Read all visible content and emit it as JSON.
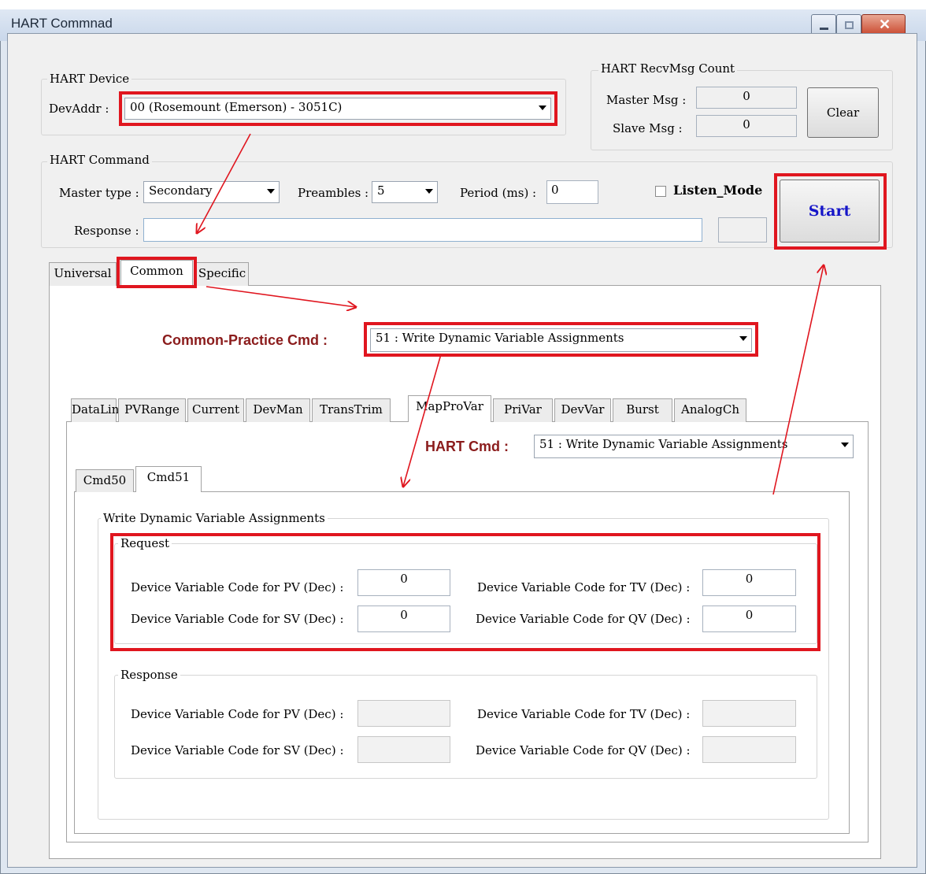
{
  "window": {
    "title": "HART Commnad"
  },
  "hart_device": {
    "group_label": "HART Device",
    "dev_addr_label": "DevAddr :",
    "dev_addr_value": "00  (Rosemount (Emerson) - 3051C)"
  },
  "recv_count": {
    "group_label": "HART RecvMsg Count",
    "master_label": "Master Msg :",
    "master_value": "0",
    "slave_label": "Slave Msg :",
    "slave_value": "0",
    "clear_label": "Clear"
  },
  "hart_command": {
    "group_label": "HART Command",
    "master_type_label": "Master type :",
    "master_type_value": "Secondary",
    "preambles_label": "Preambles :",
    "preambles_value": "5",
    "period_label": "Period (ms) :",
    "period_value": "0",
    "listen_mode_label": "Listen_Mode",
    "listen_mode_checked": false,
    "start_label": "Start",
    "response_label": "Response :",
    "response_value": ""
  },
  "top_tabs": [
    "Universal",
    "Common",
    "Specific"
  ],
  "common": {
    "cmd_label": "Common-Practice Cmd :",
    "cmd_value": "51 : Write Dynamic Variable Assignments"
  },
  "sub_tabs": [
    "DataLink",
    "PVRange",
    "Current",
    "DevMan",
    "TransTrim",
    "MapProVar",
    "PriVar",
    "DevVar",
    "Burst",
    "AnalogCh"
  ],
  "hart_cmd": {
    "label": "HART Cmd :",
    "value": "51 : Write Dynamic Variable Assignments"
  },
  "cmd_tabs": [
    "Cmd50",
    "Cmd51"
  ],
  "wdva": {
    "group_label": "Write Dynamic Variable Assignments",
    "request": {
      "label": "Request",
      "pv_label": "Device Variable Code for PV (Dec) :",
      "pv_value": "0",
      "sv_label": "Device Variable Code for SV (Dec) :",
      "sv_value": "0",
      "tv_label": "Device Variable Code for TV (Dec) :",
      "tv_value": "0",
      "qv_label": "Device Variable Code for QV (Dec) :",
      "qv_value": "0"
    },
    "response": {
      "label": "Response",
      "pv_label": "Device Variable Code for PV (Dec) :",
      "sv_label": "Device Variable Code for SV (Dec) :",
      "tv_label": "Device Variable Code for TV (Dec) :",
      "qv_label": "Device Variable Code for QV (Dec) :"
    }
  },
  "colors": {
    "highlight": "#e0161f",
    "start_text": "#1515c8",
    "cmd_label": "#8b1c1c"
  }
}
